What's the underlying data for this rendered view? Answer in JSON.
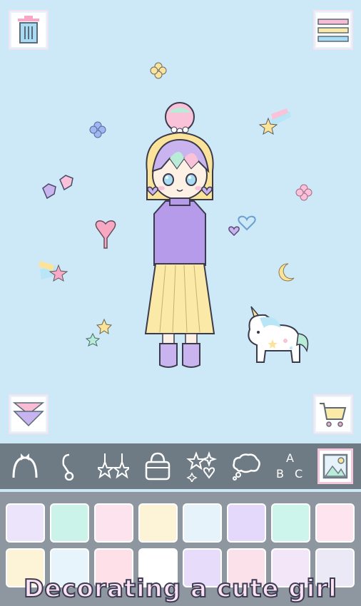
{
  "icons": {
    "trash": "trash-icon",
    "menu": "menu-icon",
    "collapse": "double-chevron-down-icon",
    "shop": "shopping-cart-icon"
  },
  "toolbar": {
    "items": [
      {
        "name": "headband-icon"
      },
      {
        "name": "earring-icon"
      },
      {
        "name": "dangle-earrings-icon"
      },
      {
        "name": "handbag-icon"
      },
      {
        "name": "sparkle-effects-icon"
      },
      {
        "name": "thought-bubble-icon"
      },
      {
        "name": "text-abc-icon",
        "text": "A B C"
      },
      {
        "name": "background-image-icon",
        "active": true
      }
    ]
  },
  "palette": {
    "swatches": [
      "#ece4fb",
      "#ccf3ea",
      "#fde3ee",
      "#fdf4d8",
      "#e6f3fb",
      "#e4d9fb",
      "#cdf5ec",
      "#fde4ee",
      "#fdf3d6",
      "#e7f4fb",
      "#fde0e8",
      "#ffffff",
      "#e8dcfb",
      "#fbe1ea",
      "#f3e6f8",
      "#ece9f6"
    ]
  },
  "caption": "Decorating a cute girl",
  "colors": {
    "stage": "#cde8f6",
    "toolbar": "#6e7a84",
    "palette": "#8e979f"
  }
}
